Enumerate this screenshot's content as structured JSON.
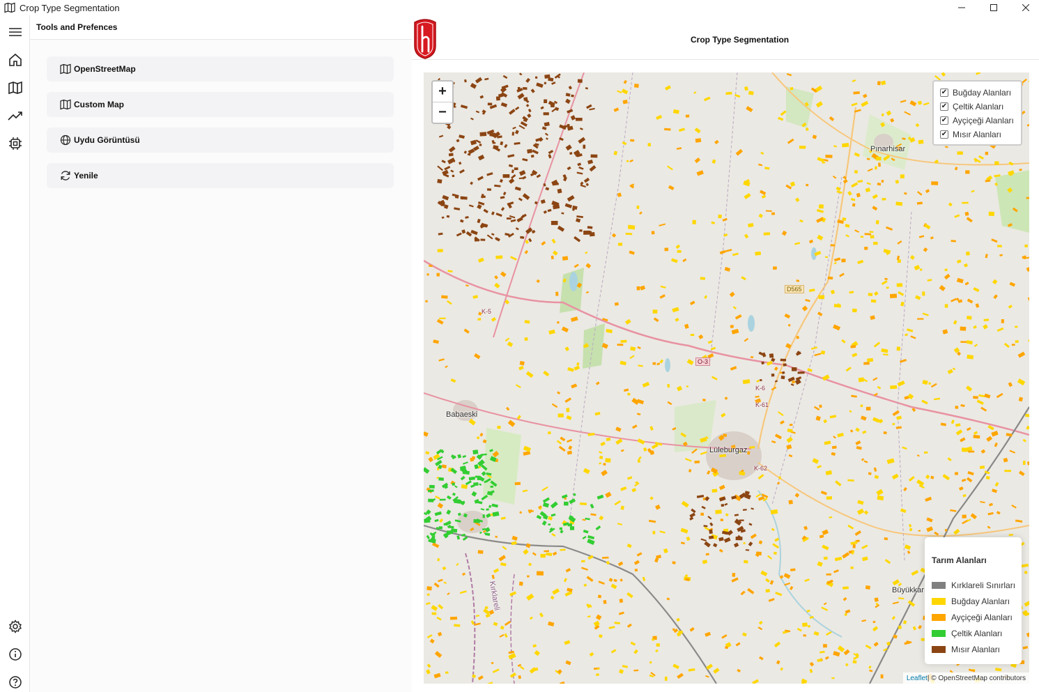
{
  "window": {
    "title": "Crop Type Segmentation"
  },
  "sidebar": {
    "header": "Tools and Prefences",
    "items": [
      {
        "label": "OpenStreetMap",
        "icon": "map-icon"
      },
      {
        "label": "Custom Map",
        "icon": "map-icon"
      },
      {
        "label": "Uydu Görüntüsü",
        "icon": "globe-icon"
      },
      {
        "label": "Yenile",
        "icon": "refresh-icon"
      }
    ]
  },
  "rail": {
    "top": [
      "menu-icon",
      "home-icon",
      "map-icon",
      "trend-icon",
      "chip-icon"
    ],
    "bottom": [
      "gear-icon",
      "info-icon",
      "help-icon"
    ]
  },
  "main": {
    "title": "Crop Type Segmentation"
  },
  "map": {
    "zoom_in": "+",
    "zoom_out": "−",
    "layers": [
      {
        "label": "Buğday Alanları",
        "checked": true
      },
      {
        "label": "Çeltik Alanları",
        "checked": true
      },
      {
        "label": "Ayçiçeği Alanları",
        "checked": true
      },
      {
        "label": "Mısır Alanları",
        "checked": true
      }
    ],
    "legend": {
      "title": "Tarım Alanları",
      "items": [
        {
          "label": "Kırklareli Sınırları",
          "color": "#808080"
        },
        {
          "label": "Buğday Alanları",
          "color": "#ffd700"
        },
        {
          "label": "Ayçiçeği Alanları",
          "color": "#ffa500"
        },
        {
          "label": "Çeltik Alanları",
          "color": "#32cd32"
        },
        {
          "label": "Mısır Alanları",
          "color": "#8b4513"
        }
      ]
    },
    "places": [
      "Pınarhisar",
      "Babaeski",
      "Lüleburgaz",
      "Büyükkarı",
      "Kırklareli"
    ],
    "road_shields": [
      "D565",
      "O-3",
      "K-5",
      "K-62",
      "K-6",
      "K-61"
    ],
    "attribution_link": "Leaflet",
    "attribution_text": " | © OpenStreetMap contributors"
  }
}
